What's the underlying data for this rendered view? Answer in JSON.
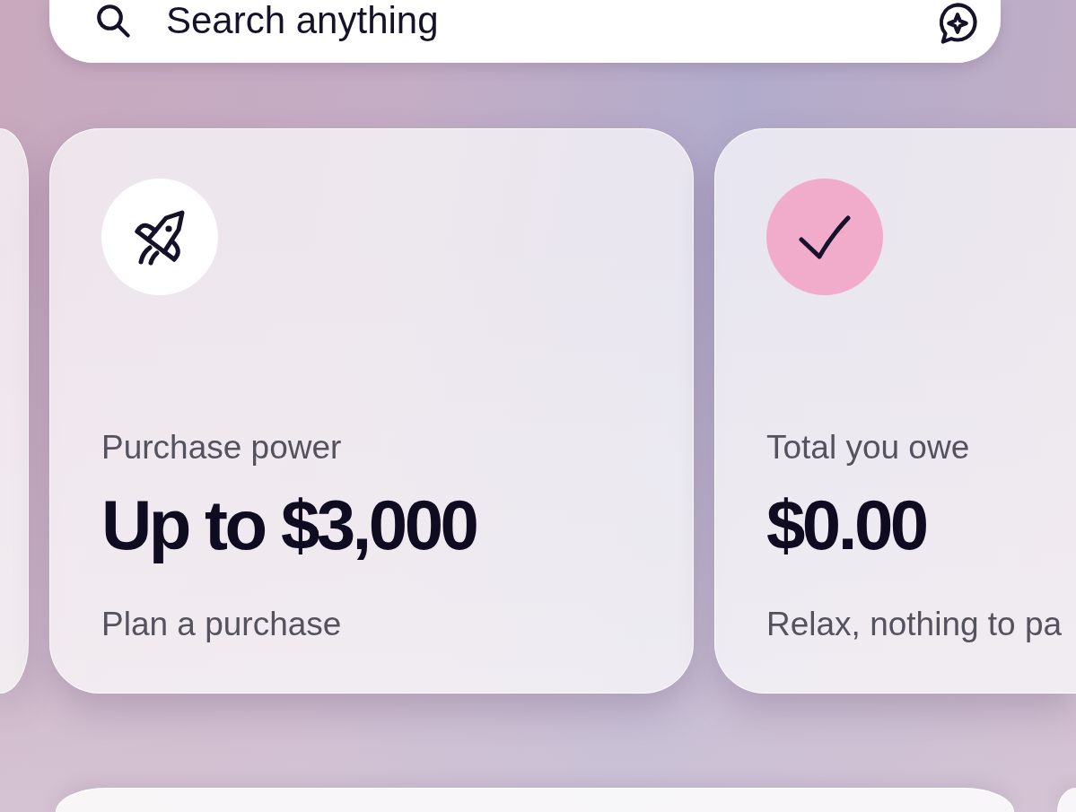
{
  "search": {
    "placeholder": "Search anything"
  },
  "cards": [
    {
      "kind": "limit",
      "label": "Purchase power",
      "amount": "Up to $3,000",
      "note": "Plan a purchase"
    },
    {
      "kind": "balance",
      "label": "Total you owe",
      "amount": "$0.00",
      "note": "Relax, nothing to pa"
    }
  ]
}
